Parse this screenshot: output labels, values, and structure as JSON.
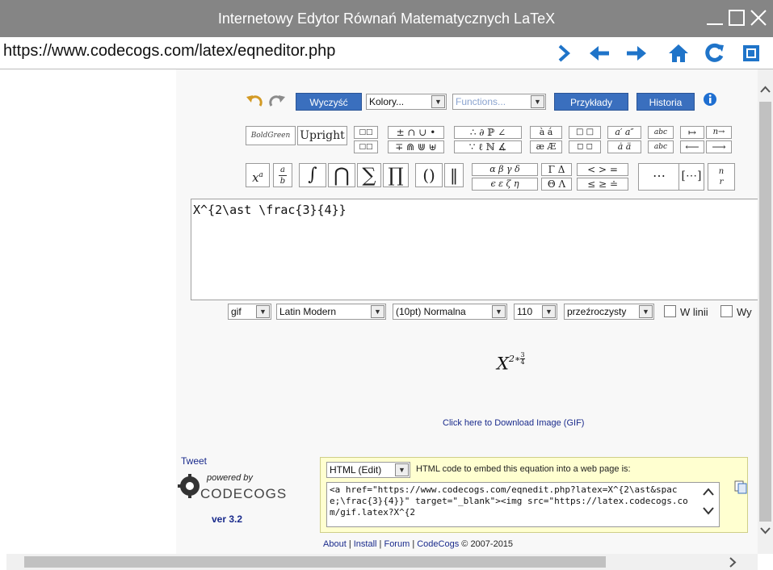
{
  "window": {
    "title": "Internetowy Edytor Równań Matematycznych LaTeX"
  },
  "address_bar": {
    "url": "https://www.codecogs.com/latex/eqneditor.php"
  },
  "toolbar": {
    "clear_label": "Wyczyść",
    "colors_select": "Kolory...",
    "functions_select": "Functions...",
    "examples_label": "Przykłady",
    "history_label": "Historia"
  },
  "symbols": {
    "bold_green": "BoldGreen",
    "upright": "Upright",
    "superscript": "x",
    "superscript_exp": "a",
    "fraction_num": "a",
    "fraction_den": "b",
    "integral": "∫",
    "intersection": "⋂",
    "sum": "∑",
    "product": "∏",
    "parens": "()",
    "norm": "‖",
    "greek_row1": "α β γ δ",
    "greek_row2": "ϵ ε ζ η",
    "upper_greek_row1": "Γ Δ",
    "upper_greek_row2": "Θ Λ",
    "rel_row1": "< > =",
    "rel_row2": "≤ ≥ ≐",
    "dots": "⋯",
    "binom_n": "n",
    "binom_r": "r",
    "pm_row1": "± ∩ ∪ •",
    "pm_row2": "∓ ⋒ ⋓ ⊎",
    "logic_row1": "∴ ∂ ℙ ∠",
    "logic_row2": "∵ ℓ ℕ ∡",
    "accent_row1": "à á",
    "accent_row2": "æ Æ",
    "box_row1": "□ □",
    "box_row2": "◻ ◻",
    "prime_row1": "a′ a″",
    "dot_row2": "ȧ ä",
    "arrow_row1_a": "↦",
    "arrow_row1_b": "n→",
    "arrow_row2_a": "⟵",
    "arrow_row2_b": "⟶",
    "abc_row1": "abc",
    "abc_row2": "abc"
  },
  "editor": {
    "latex": "X^{2\\ast \\frac{3}{4}}"
  },
  "format_bar": {
    "format": "gif",
    "font": "Latin Modern",
    "size": "(10pt) Normalna",
    "dpi": "110",
    "background": "przeźroczysty",
    "inline_label": "W linii",
    "wy_label": "Wy"
  },
  "preview": {
    "base": "X",
    "exp_base": "2∗",
    "exp_num": "3",
    "exp_den": "4",
    "download_link": "Click here to Download Image (GIF)"
  },
  "sidebar": {
    "tweet": "Tweet",
    "powered_by": "powered by",
    "brand": "CODECOGS",
    "version": "ver 3.2"
  },
  "embed": {
    "mode": "HTML (Edit)",
    "description": "HTML code to embed this equation into a web page is:",
    "code": "<a href=\"https://www.codecogs.com/eqnedit.php?latex=X^{2\\ast&space;\\frac{3}{4}}\" target=\"_blank\"><img src=\"https://latex.codecogs.com/gif.latex?X^{2"
  },
  "footer": {
    "about": "About",
    "install": "Install",
    "forum": "Forum",
    "codecogs": "CodeCogs",
    "copyright": "© 2007-2015"
  },
  "colors": {
    "titlebar": "#858585",
    "nav_blue": "#1f74c9",
    "button_blue": "#3a6fbe",
    "link_blue": "#1a2b8c",
    "embed_bg": "#ffffd0"
  }
}
